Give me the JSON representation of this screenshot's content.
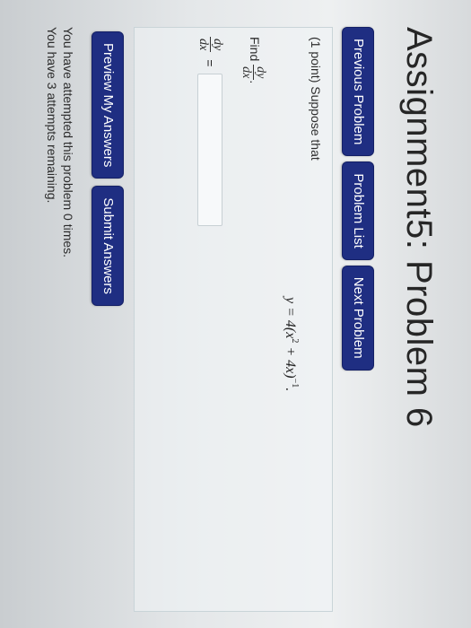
{
  "header": {
    "title": "Assignment5: Problem 6"
  },
  "nav": {
    "previous_label": "Previous Problem",
    "list_label": "Problem List",
    "next_label": "Next Problem"
  },
  "problem": {
    "intro": "(1 point) Suppose that",
    "equation": {
      "lhs": "y = 4(x",
      "exp1": "2",
      "mid": " + 4x)",
      "exp2": "−1",
      "end": "."
    },
    "find_label": "Find",
    "derivative": {
      "numerator": "dy",
      "denominator": "dx"
    },
    "find_end": ".",
    "answer_equals": "=",
    "answer_value": ""
  },
  "actions": {
    "preview_label": "Preview My Answers",
    "submit_label": "Submit Answers"
  },
  "status": {
    "attempted": "You have attempted this problem 0 times.",
    "remaining": "You have 3 attempts remaining."
  },
  "colors": {
    "button_bg": "#1f2e82",
    "button_text": "#ffffff"
  }
}
